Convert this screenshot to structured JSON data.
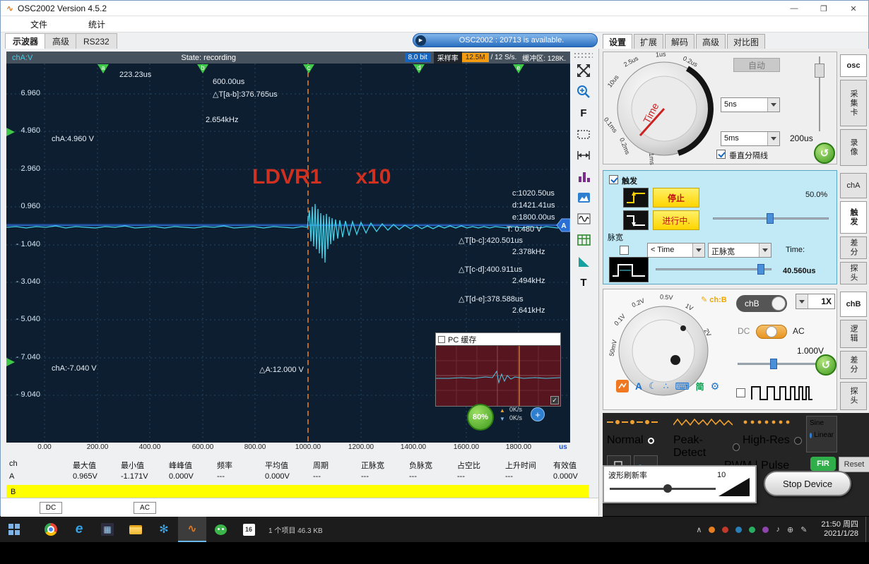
{
  "glyphs": {
    "min": "—",
    "max": "❐",
    "close": "✕",
    "play": "▶",
    "undo": "↺",
    "moon": "☾",
    "gear": "⚙",
    "kbd": "⌨",
    "dots": "∴",
    "pen": "✎",
    "note": "♪",
    "chev": "∧",
    "globe": "⊕",
    "snow": "✻",
    "wave": "∿",
    "e": "e",
    "calc": "▦",
    "plus": "+",
    "up": "▲",
    "down": "▼"
  },
  "window": {
    "title": "OSC2002  Version 4.5.2"
  },
  "menu": {
    "items": [
      "文件",
      "统计"
    ]
  },
  "doc_tabs": {
    "items": [
      "示波器",
      "高级",
      "RS232"
    ]
  },
  "notification": {
    "text": "OSC2002 : 20713 is available."
  },
  "panel_tabs": {
    "items": [
      "设置",
      "扩展",
      "解码",
      "高级",
      "对比图"
    ]
  },
  "statusbar": {
    "state": "State: recording",
    "bit": "8.0 bit",
    "rate_label": "采样率",
    "rate_value": "12.5M",
    "rate_suffix": "/ 12 S/s.",
    "buffer": "缓冲区: 128K."
  },
  "plot": {
    "ch_axis": "chA:V",
    "y_labels": [
      "6.960",
      "4.960",
      "2.960",
      "0.960",
      "- 1.040",
      "- 3.040",
      "- 5.040",
      "- 7.040",
      "- 9.040"
    ],
    "x_labels": [
      "0.00",
      "200.00",
      "400.00",
      "600.00",
      "800.00",
      "1000.00",
      "1200.00",
      "1400.00",
      "1600.00",
      "1800.00"
    ],
    "x_unit": "us",
    "markers": [
      "a",
      "b",
      "c",
      "d",
      "e"
    ],
    "trigger_flag": "A",
    "ann": {
      "a_time": "223.23us",
      "b_time": "600.00us",
      "t_ab": "△T[a-b]:376.765us",
      "f_ab": "2.654kHz",
      "lm_top": "chA:4.960 V",
      "lm_bottom": "chA:-7.040 V",
      "c_time": "c:1020.50us",
      "d_time": "d:1421.41us",
      "e_time": "e:1800.00us",
      "trig_v": "T: 0.480 V",
      "t_bc": "△T[b-c]:420.501us",
      "f_bc": "2.378kHz",
      "t_cd": "△T[c-d]:400.911us",
      "f_cd": "2.494kHz",
      "t_de": "△T[d-e]:378.588us",
      "f_de": "2.641kHz",
      "delta_a": "△A:12.000 V",
      "ovl1": "LDVR1",
      "ovl2": "x10"
    },
    "pc_title": "PC 缓存",
    "progress": "80%",
    "up_rate": "0K/s",
    "down_rate": "0K/s"
  },
  "tools": {
    "f": "F",
    "t": "T"
  },
  "table": {
    "headers": [
      "ch",
      "最大值",
      "最小值",
      "峰峰值",
      "频率",
      "平均值",
      "周期",
      "正脉宽",
      "负脉宽",
      "占空比",
      "上升时间",
      "有效值"
    ],
    "row_a": [
      "A",
      "0.965V",
      "-1.171V",
      "0.000V",
      "---",
      "0.000V",
      "---",
      "---",
      "---",
      "---",
      "---",
      "0.000V"
    ],
    "row_b": "B",
    "dc": "DC",
    "ac": "AC"
  },
  "time_panel": {
    "knob": "Time",
    "ticks": [
      "10us",
      "2.5us",
      "1us",
      "0.2us",
      "0.1ms",
      "0.2ms",
      "1ms"
    ],
    "auto": "自动",
    "dd_fast": "5ns",
    "dd_slow": "5ms",
    "value": "200us",
    "vsep": "垂直分隔线"
  },
  "side1": [
    "osc",
    "采集卡",
    "录像"
  ],
  "trigger_panel": {
    "title": "触发",
    "stop": "停止",
    "running": "进行中.",
    "level": "50.0%",
    "pulse": "脉宽",
    "cmp": "< Time",
    "mode": "正脉宽",
    "time_label": "Time:",
    "time_value": "40.560us"
  },
  "side2": [
    "chA",
    "触发",
    "差分",
    "探头"
  ],
  "volt_panel": {
    "tag": "ch:B",
    "chb": "chB",
    "mult": "1X",
    "dc": "DC",
    "ac": "AC",
    "value": "1.000V",
    "lang": "简",
    "a": "A",
    "ticks": [
      "50mV",
      "0.1V",
      "0.2V",
      "0.5V",
      "1V",
      "2V"
    ]
  },
  "side3": [
    "chB",
    "逻辑",
    "差分",
    "探头"
  ],
  "acq": {
    "normal": "Normal",
    "peak": "Peak-Detect",
    "hires": "High-Res",
    "sine": "Sine",
    "linear": "Linear",
    "pwm": "PWM | Pulse",
    "fir": "FIR",
    "reset": "Reset"
  },
  "refresh": {
    "label": "波形刷新率",
    "value": "10",
    "stop": "Stop Device"
  },
  "taskbar": {
    "status": "1 个项目   46.3 KB",
    "badge": "16",
    "time": "21:50 周四",
    "date": "2021/1/28"
  }
}
